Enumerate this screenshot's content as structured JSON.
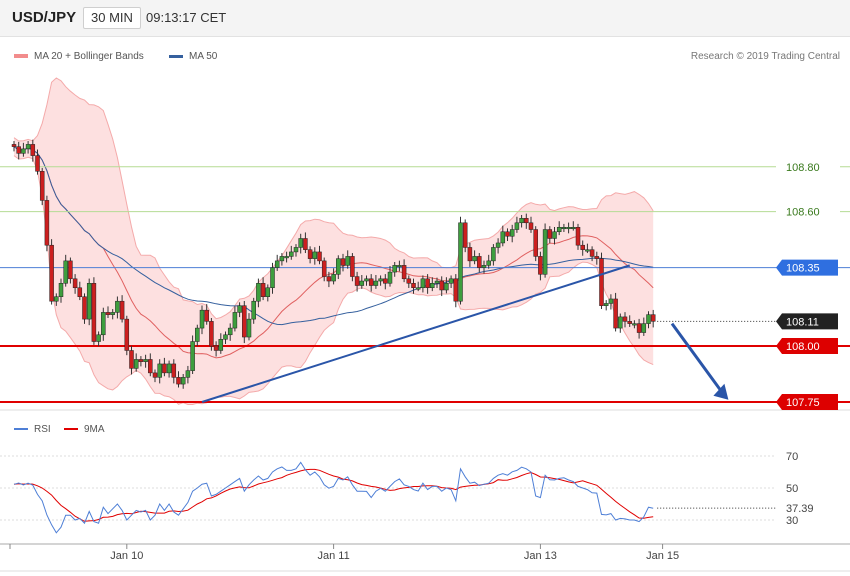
{
  "header": {
    "symbol": "USD/JPY",
    "timeframe": "30 MIN",
    "time": "09:13:17 CET"
  },
  "legend": {
    "bb_label": "MA 20 + Bollinger Bands",
    "ma50_label": "MA 50"
  },
  "copyright": "Research © 2019 Trading Central",
  "rsi_legend": {
    "rsi_label": "RSI",
    "ma_label": "9MA"
  },
  "colors": {
    "bull": "#3e9e3e",
    "bear": "#cc1f1f",
    "ma20": "#e06060",
    "band_fill": "#fde0e0",
    "ma50": "#35609e",
    "support": "#e00000",
    "resistance": "#b5dc94",
    "pivot": "#4e7fd6",
    "rsi": "#4e7fd6",
    "rsi_ma": "#e00000"
  },
  "chart_data": [
    {
      "type": "candlestick",
      "title": "USD/JPY 30 MIN",
      "x_ticks": [
        {
          "label": "Jan 10",
          "i": 24
        },
        {
          "label": "Jan 11",
          "i": 68
        },
        {
          "label": "Jan 13",
          "i": 112
        },
        {
          "label": "Jan 15",
          "i": 138
        }
      ],
      "y_labels": [
        "108.80",
        "108.60",
        "108.35",
        "108.11",
        "108.00",
        "107.75"
      ],
      "last_price": "108.11",
      "levels": [
        {
          "value": 108.8,
          "label": "108.80",
          "kind": "resistance"
        },
        {
          "value": 108.6,
          "label": "108.60",
          "kind": "resistance"
        },
        {
          "value": 108.35,
          "label": "108.35",
          "kind": "pivot"
        },
        {
          "value": 108.0,
          "label": "108.00",
          "kind": "support"
        },
        {
          "value": 107.75,
          "label": "107.75",
          "kind": "support"
        }
      ],
      "trendline": {
        "from": {
          "i": 40,
          "price": 107.75
        },
        "to": {
          "i": 131,
          "price": 108.36
        }
      },
      "forecast_arrow": {
        "from": {
          "i": 140,
          "price": 108.1
        },
        "to": {
          "i": 152,
          "price": 107.76
        }
      },
      "close_start": 108.9,
      "closes": [
        108.89,
        108.86,
        108.88,
        108.9,
        108.85,
        108.78,
        108.65,
        108.45,
        108.2,
        108.22,
        108.28,
        108.38,
        108.3,
        108.26,
        108.22,
        108.12,
        108.28,
        108.02,
        108.05,
        108.15,
        108.14,
        108.15,
        108.2,
        108.12,
        107.98,
        107.9,
        107.94,
        107.93,
        107.94,
        107.88,
        107.86,
        107.92,
        107.88,
        107.92,
        107.86,
        107.83,
        107.86,
        107.89,
        108.02,
        108.08,
        108.16,
        108.11,
        108.0,
        107.98,
        108.03,
        108.05,
        108.08,
        108.15,
        108.18,
        108.04,
        108.12,
        108.2,
        108.28,
        108.22,
        108.26,
        108.35,
        108.38,
        108.4,
        108.4,
        108.42,
        108.44,
        108.48,
        108.43,
        108.39,
        108.42,
        108.38,
        108.31,
        108.29,
        108.32,
        108.39,
        108.36,
        108.4,
        108.31,
        108.27,
        108.29,
        108.3,
        108.27,
        108.29,
        108.3,
        108.28,
        108.33,
        108.36,
        108.36,
        108.3,
        108.28,
        108.26,
        108.26,
        108.3,
        108.26,
        108.28,
        108.29,
        108.25,
        108.28,
        108.3,
        108.2,
        108.55,
        108.44,
        108.38,
        108.4,
        108.35,
        108.36,
        108.38,
        108.44,
        108.46,
        108.51,
        108.49,
        108.52,
        108.55,
        108.57,
        108.55,
        108.52,
        108.4,
        108.32,
        108.52,
        108.48,
        108.51,
        108.53,
        108.53,
        108.53,
        108.53,
        108.45,
        108.43,
        108.43,
        108.4,
        108.39,
        108.18,
        108.19,
        108.21,
        108.08,
        108.13,
        108.11,
        108.1,
        108.1,
        108.06,
        108.1,
        108.14,
        108.11
      ],
      "rsi": {
        "y_ticks": [
          70,
          50,
          30
        ],
        "ylim": [
          18,
          78
        ],
        "last_value": "37.39",
        "values": [
          52.3,
          53.1,
          51.9,
          53,
          51.8,
          46,
          42,
          33.1,
          27,
          22,
          25.5,
          33,
          33,
          30,
          31,
          28,
          35.4,
          29,
          28,
          38,
          34,
          37,
          40,
          36,
          30,
          33,
          36,
          35,
          36,
          30,
          33,
          40,
          36,
          40,
          35,
          33,
          37,
          41,
          48,
          50,
          52.4,
          53,
          45,
          46,
          48,
          50,
          52,
          54,
          56,
          48,
          52,
          55,
          57.5,
          55,
          56,
          60,
          62,
          63.1,
          61,
          61,
          62,
          66,
          61.4,
          58,
          60,
          57,
          52,
          49.9,
          51,
          56,
          55,
          57,
          52,
          48,
          48,
          47.9,
          44,
          48,
          49.8,
          48,
          51,
          54,
          55.7,
          52,
          51,
          49,
          48.1,
          53,
          49,
          51,
          51,
          48,
          50,
          49,
          42,
          62,
          57,
          53,
          53.6,
          51.5,
          52.4,
          53,
          56,
          58,
          59,
          58,
          60.1,
          61,
          63,
          62,
          60,
          45,
          44,
          58,
          55.1,
          55,
          56,
          56.4,
          55,
          54,
          51,
          50,
          49,
          47,
          46.8,
          33.5,
          33.2,
          34,
          30,
          31,
          30.7,
          30,
          30,
          29,
          32,
          38,
          37.39
        ]
      }
    }
  ]
}
